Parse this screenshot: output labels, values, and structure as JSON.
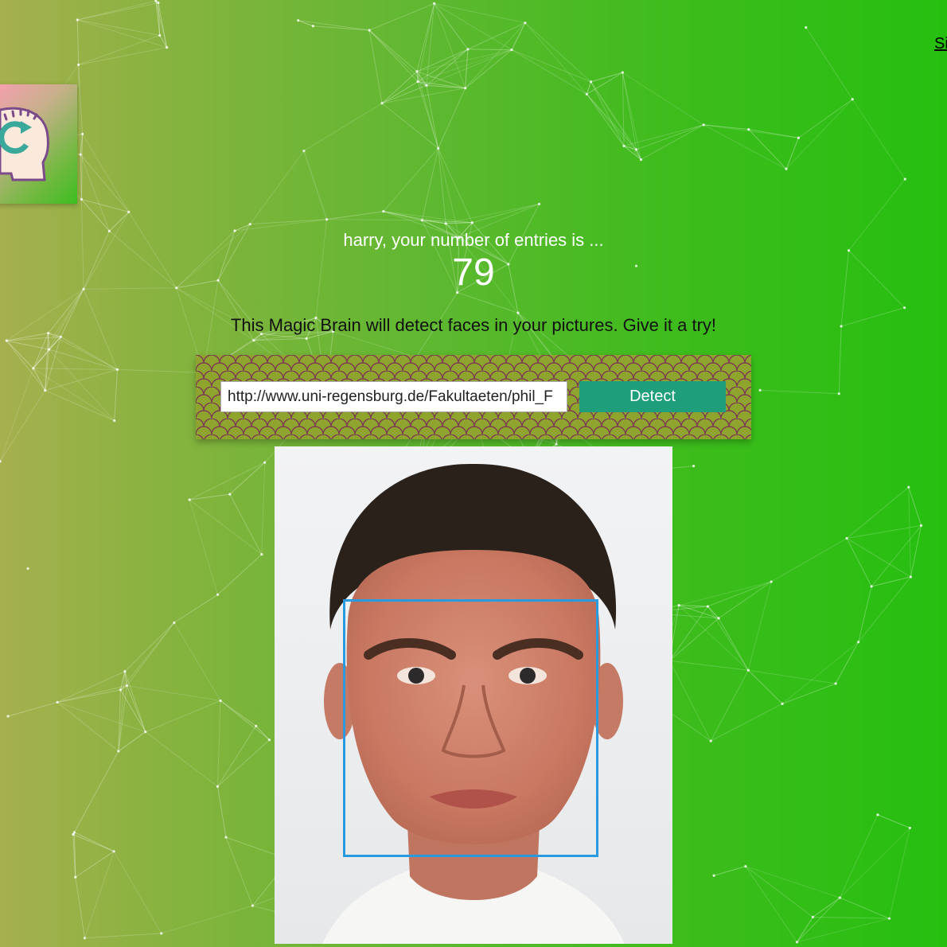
{
  "nav": {
    "signout_label": "Sign Out"
  },
  "logo": {
    "icon": "brain-head-refresh-icon"
  },
  "rank": {
    "greeting": "harry, your number of entries is ...",
    "count": "79"
  },
  "intro": {
    "text": "This Magic Brain will detect faces in your pictures. Give it a try!"
  },
  "image_link_form": {
    "input_value": "http://www.uni-regensburg.de/Fakultaeten/phil_F",
    "button_label": "Detect"
  },
  "face_recognition": {
    "image_description_icon": "face-photo",
    "box_color": "#2a9ae0"
  },
  "theme": {
    "button_color": "#1e9e7a",
    "text_light": "#ffffff"
  }
}
